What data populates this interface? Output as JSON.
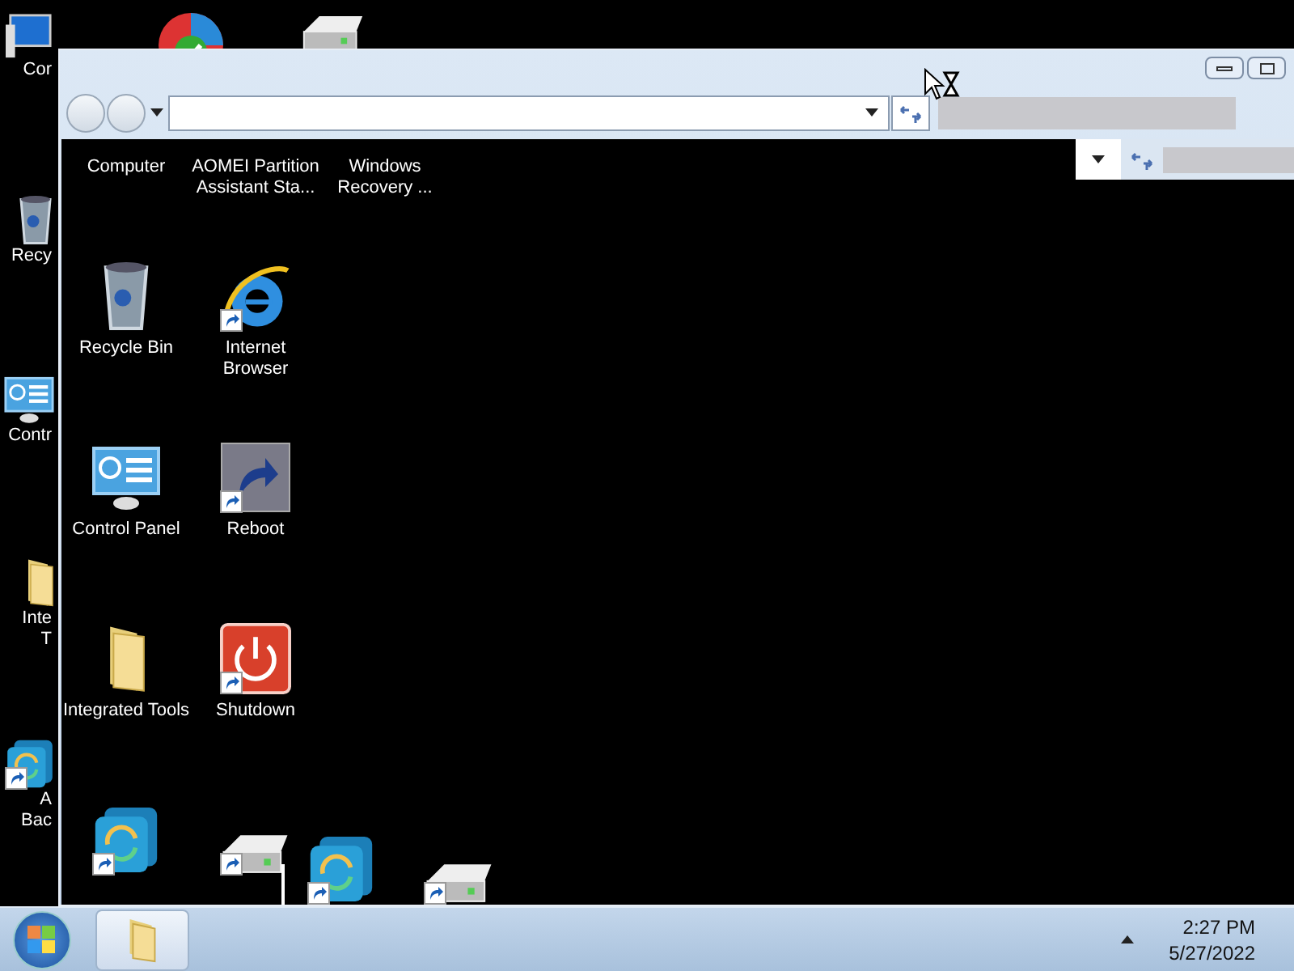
{
  "desktop_icons": [
    {
      "kind": "computer",
      "lines": [
        "Cor"
      ]
    },
    {
      "kind": "recycle",
      "lines": [
        "Recy"
      ]
    },
    {
      "kind": "control",
      "lines": [
        "Contr"
      ]
    },
    {
      "kind": "folder",
      "lines": [
        "Inte",
        "T"
      ]
    },
    {
      "kind": "backup",
      "shortcut": true,
      "lines": [
        "A",
        "Bac"
      ]
    }
  ],
  "top_icons": [
    {
      "kind": "check"
    },
    {
      "kind": "drive"
    }
  ],
  "window": {
    "items": [
      {
        "kind": "none",
        "name": "Computer"
      },
      {
        "kind": "none",
        "name": "AOMEI Partition Assistant Sta..."
      },
      {
        "kind": "none",
        "name": "Windows Recovery ..."
      },
      {
        "kind": "recycle",
        "shortcut": false,
        "name": "Recycle Bin"
      },
      {
        "kind": "browser",
        "shortcut": true,
        "name": "Internet Browser"
      },
      {
        "kind": "empty"
      },
      {
        "kind": "control",
        "shortcut": false,
        "name": "Control Panel"
      },
      {
        "kind": "reboot",
        "shortcut": true,
        "name": "Reboot"
      },
      {
        "kind": "empty"
      },
      {
        "kind": "folder",
        "shortcut": false,
        "name": "Integrated Tools"
      },
      {
        "kind": "shutdown",
        "shortcut": true,
        "name": "Shutdown"
      },
      {
        "kind": "empty"
      },
      {
        "kind": "backup",
        "shortcut": true
      },
      {
        "kind": "drive",
        "shortcut": true
      },
      {
        "kind": "empty"
      }
    ],
    "ghost_icons": [
      {
        "kind": "backup",
        "shortcut": true
      },
      {
        "kind": "drive",
        "shortcut": true
      }
    ]
  },
  "taskbar": {
    "time": "2:27 PM",
    "date": "5/27/2022"
  }
}
